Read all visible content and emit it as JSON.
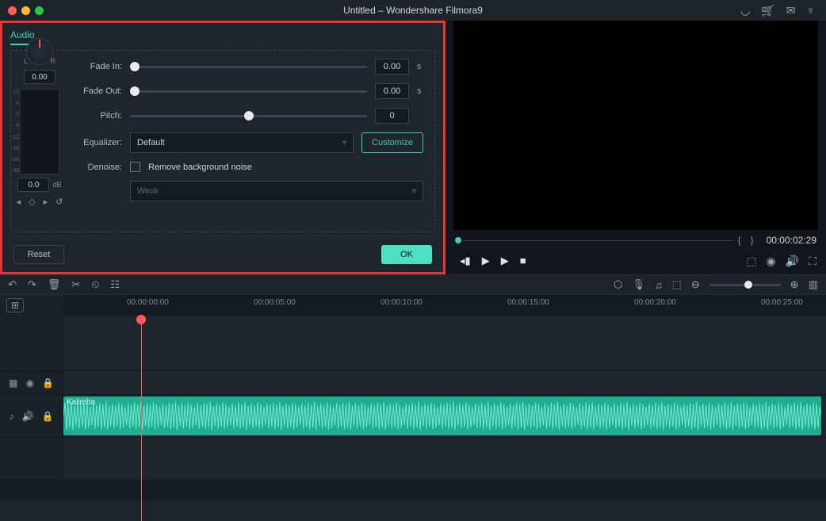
{
  "title": "Untitled – Wondershare Filmora9",
  "audio_tab": "Audio",
  "knob_value": "0.00",
  "db_value": "0.0",
  "db_unit": "dB",
  "vu_scale": [
    "12",
    "6",
    "0",
    "-6",
    "-12",
    "-18",
    "-24",
    "-30"
  ],
  "labels": {
    "fadein": "Fade In:",
    "fadeout": "Fade Out:",
    "pitch": "Pitch:",
    "equalizer": "Equalizer:",
    "denoise": "Denoise:"
  },
  "fadein_val": "0.00",
  "fadeout_val": "0.00",
  "pitch_val": "0",
  "unit_s": "s",
  "equalizer_sel": "Default",
  "customize": "Customize",
  "denoise_chk": "Remove background noise",
  "denoise_level": "Weak",
  "reset": "Reset",
  "ok": "OK",
  "timestamp": "00:00:02:29",
  "ruler": [
    "00:00:00:00",
    "00:00:05:00",
    "00:00:10:00",
    "00:00:15:00",
    "00:00:20:00",
    "00:00:25:00"
  ],
  "clip_name": "Kalimba"
}
